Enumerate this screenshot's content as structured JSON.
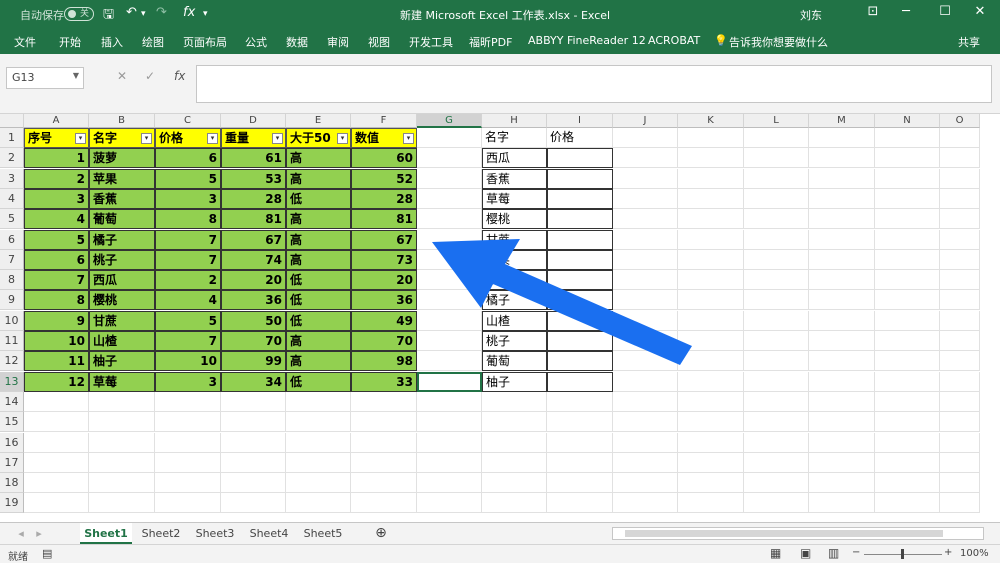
{
  "titlebar": {
    "autosave_label": "自动保存",
    "autosave_state": "关",
    "title": "新建 Microsoft Excel 工作表.xlsx  -  Excel",
    "user": "刘东",
    "minimize": "─",
    "maximize": "☐",
    "close": "✕",
    "ribbon_display": "⊡",
    "save_icon": "🖫",
    "undo_icon": "↶",
    "redo_icon": "↷",
    "sep_icon": "▾"
  },
  "ribbon": {
    "tabs": [
      "文件",
      "开始",
      "插入",
      "绘图",
      "页面布局",
      "公式",
      "数据",
      "审阅",
      "视图",
      "开发工具",
      "福昕PDF",
      "ABBYY FineReader 12",
      "ACROBAT",
      "告诉我你想要做什么"
    ],
    "share": "共享",
    "tell_icon": "💡"
  },
  "formula": {
    "namebox": "G13",
    "cancel": "✕",
    "enter": "✓",
    "fx": "fx",
    "content": ""
  },
  "columns": [
    "A",
    "B",
    "C",
    "D",
    "E",
    "F",
    "G",
    "H",
    "I",
    "J",
    "K",
    "L",
    "M",
    "N",
    "O"
  ],
  "rows": [
    "1",
    "2",
    "3",
    "4",
    "5",
    "6",
    "7",
    "8",
    "9",
    "10",
    "11",
    "12",
    "13",
    "14",
    "15",
    "16",
    "17",
    "18",
    "19"
  ],
  "table_headers": [
    "序号",
    "名字",
    "价格",
    "重量",
    "大于50",
    "数值"
  ],
  "table_rows": [
    [
      "1",
      "菠萝",
      "6",
      "61",
      "高",
      "60"
    ],
    [
      "2",
      "苹果",
      "5",
      "53",
      "高",
      "52"
    ],
    [
      "3",
      "香蕉",
      "3",
      "28",
      "低",
      "28"
    ],
    [
      "4",
      "葡萄",
      "8",
      "81",
      "高",
      "81"
    ],
    [
      "5",
      "橘子",
      "7",
      "67",
      "高",
      "67"
    ],
    [
      "6",
      "桃子",
      "7",
      "74",
      "高",
      "73"
    ],
    [
      "7",
      "西瓜",
      "2",
      "20",
      "低",
      "20"
    ],
    [
      "8",
      "樱桃",
      "4",
      "36",
      "低",
      "36"
    ],
    [
      "9",
      "甘蔗",
      "5",
      "50",
      "低",
      "49"
    ],
    [
      "10",
      "山楂",
      "7",
      "70",
      "高",
      "70"
    ],
    [
      "11",
      "柚子",
      "10",
      "99",
      "高",
      "98"
    ],
    [
      "12",
      "草莓",
      "3",
      "34",
      "低",
      "33"
    ]
  ],
  "lookup_headers": [
    "名字",
    "价格"
  ],
  "lookup_names": [
    "西瓜",
    "香蕉",
    "草莓",
    "樱桃",
    "甘蔗",
    "苹果",
    "菠萝",
    "橘子",
    "山楂",
    "桃子",
    "葡萄",
    "柚子"
  ],
  "sheets": [
    "Sheet1",
    "Sheet2",
    "Sheet3",
    "Sheet4",
    "Sheet5"
  ],
  "add_sheet": "⊕",
  "status": {
    "ready": "就绪",
    "zoom": "100%",
    "zoom_minus": "−",
    "zoom_plus": "+"
  },
  "colors": {
    "excel_green": "#217346",
    "header_yellow": "#ffff00",
    "data_green": "#92d050",
    "arrow_blue": "#1a6ff0"
  }
}
